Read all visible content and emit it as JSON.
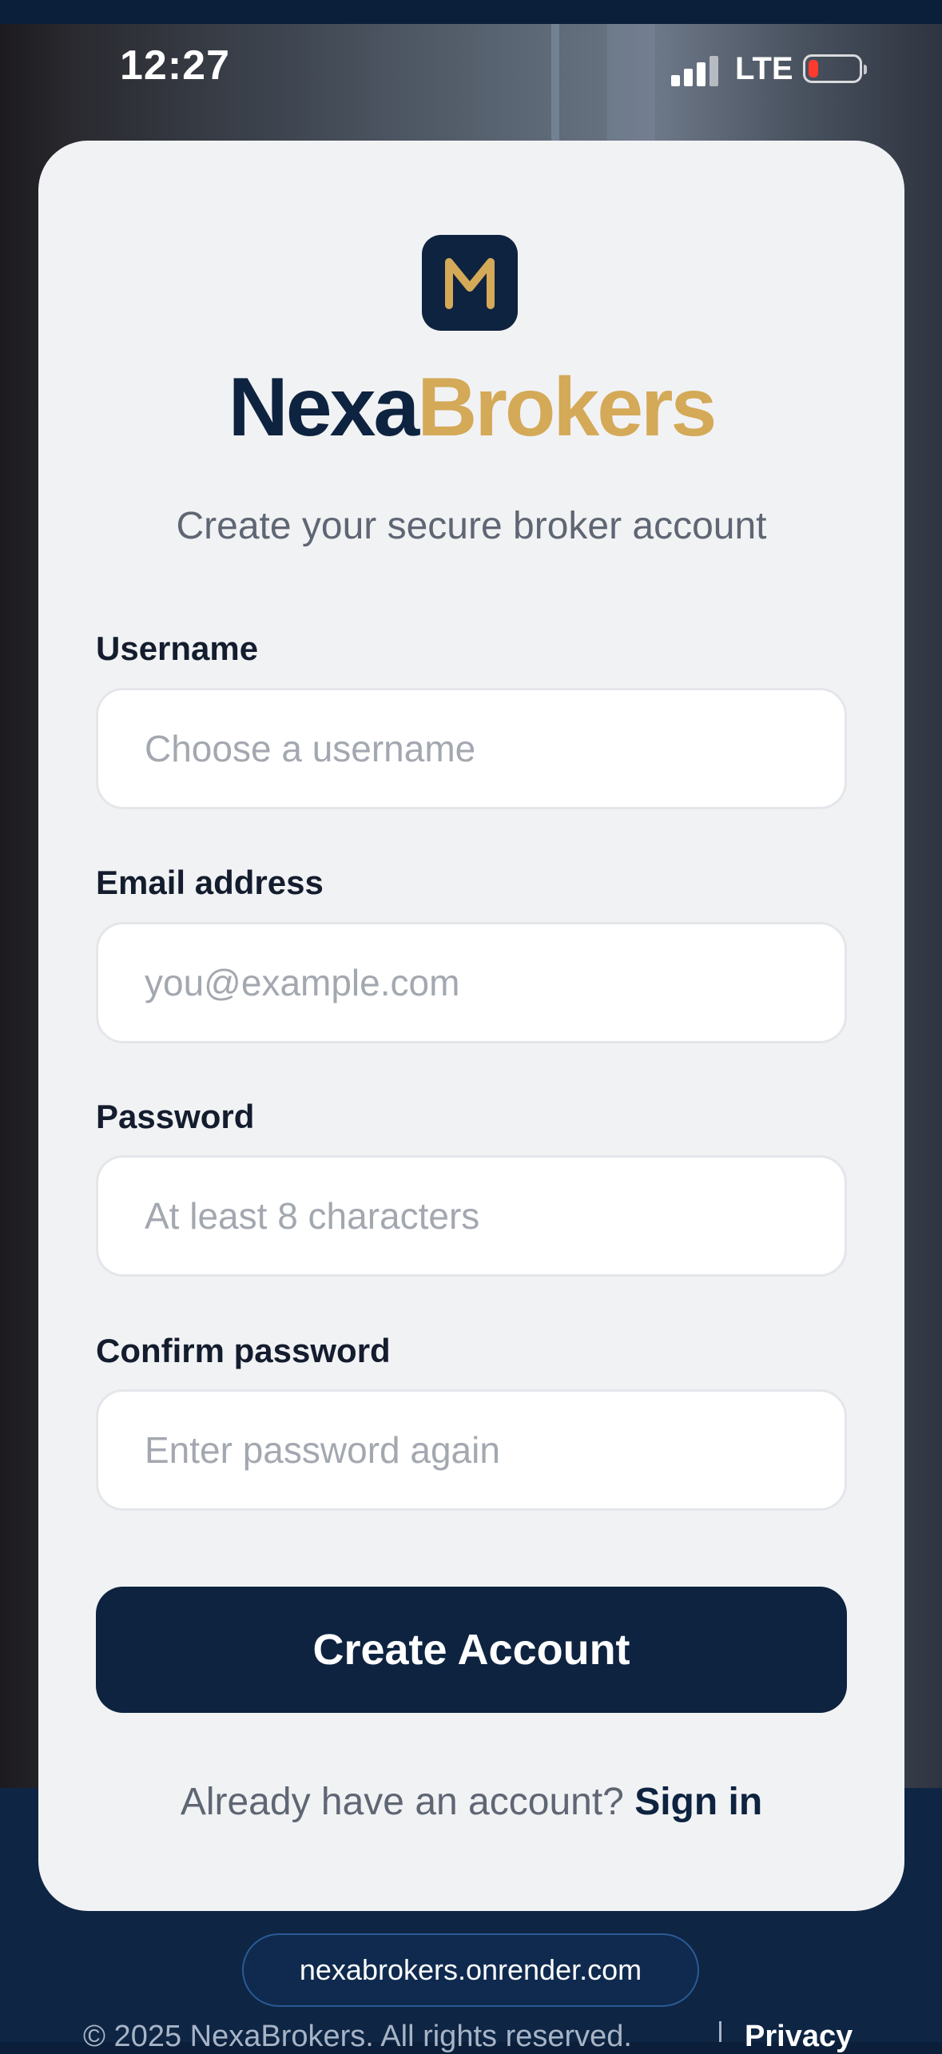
{
  "status_bar": {
    "time": "12:27",
    "network": "LTE",
    "battery_level": 0.1
  },
  "brand": {
    "logo_letter": "M",
    "name_part1": "Nexa",
    "name_part2": "Brokers",
    "primary_color": "#0e2340",
    "accent_color": "#d4a957"
  },
  "subtitle": "Create your secure broker account",
  "form": {
    "username": {
      "label": "Username",
      "placeholder": "Choose a username",
      "value": ""
    },
    "email": {
      "label": "Email address",
      "placeholder": "you@example.com",
      "value": ""
    },
    "password": {
      "label": "Password",
      "placeholder": "At least 8 characters",
      "value": ""
    },
    "confirm_password": {
      "label": "Confirm password",
      "placeholder": "Enter password again",
      "value": ""
    },
    "submit_label": "Create Account"
  },
  "signin": {
    "prompt": "Already have an account?",
    "link_label": "Sign in"
  },
  "browser": {
    "url": "nexabrokers.onrender.com"
  },
  "footer": {
    "copyright": "© 2025 NexaBrokers. All rights reserved.",
    "privacy_label": "Privacy"
  }
}
